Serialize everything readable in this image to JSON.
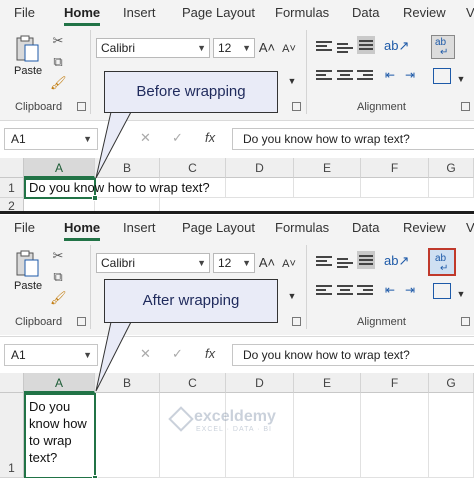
{
  "ribbon": {
    "tabs": [
      "File",
      "Home",
      "Insert",
      "Page Layout",
      "Formulas",
      "Data",
      "Review"
    ],
    "tabs_partial": "V",
    "active_tab": "Home",
    "paste_label": "Paste",
    "clipboard_label": "Clipboard",
    "alignment_label": "Alignment",
    "font_name": "Calibri",
    "font_size": "12",
    "accent_color": "#217346"
  },
  "formula_bar": {
    "name_box": "A1",
    "content": "Do you know how to wrap text?"
  },
  "grid": {
    "columns": [
      "A",
      "B",
      "C",
      "D",
      "E",
      "F",
      "G"
    ],
    "rows_before": [
      "1",
      "2"
    ],
    "rows_after": [
      "1"
    ]
  },
  "before": {
    "callout": "Before wrapping",
    "cell_text": "Do you know how to wrap text?"
  },
  "after": {
    "callout": "After wrapping",
    "cell_lines": [
      "Do you",
      "know how",
      "to wrap",
      "text?"
    ]
  },
  "watermark": {
    "name": "exceldemy",
    "tagline": "EXCEL · DATA · BI"
  }
}
